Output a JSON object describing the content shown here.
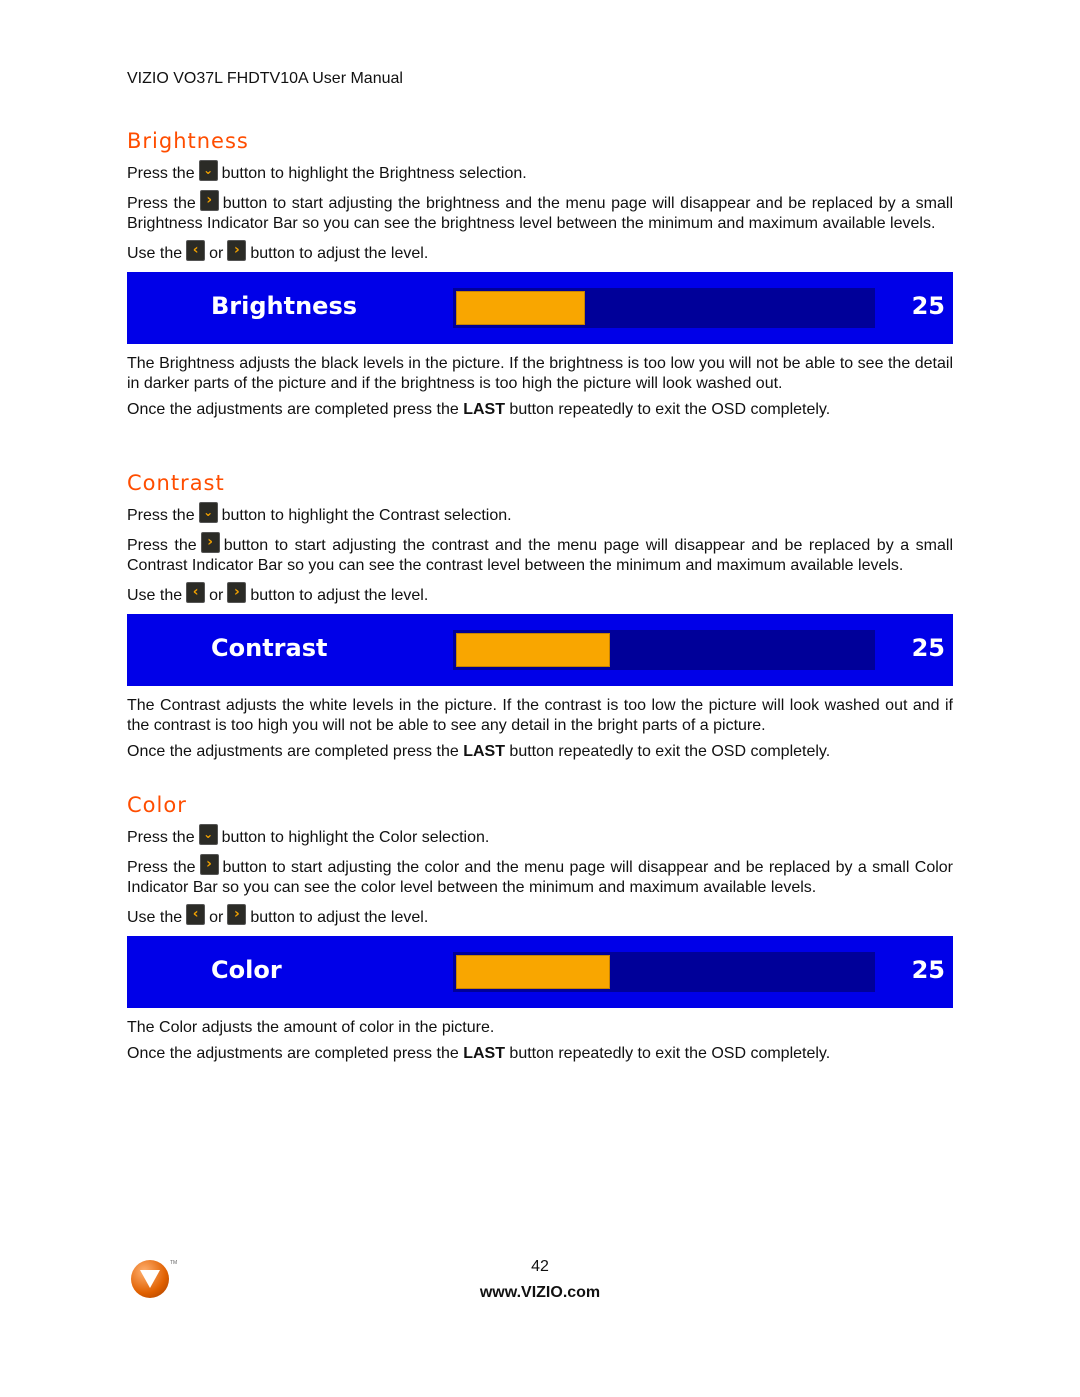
{
  "header": {
    "title": "VIZIO VO37L FHDTV10A User Manual"
  },
  "sections": [
    {
      "title": "Brightness",
      "highlight": {
        "pre": "Press the",
        "post": "button to highlight the Brightness selection."
      },
      "start": {
        "pre": "Press the",
        "post": "button to start adjusting the brightness and the menu page will disappear and be replaced by a small Brightness Indicator Bar so you can see the brightness level between the minimum and maximum available levels."
      },
      "adjust": {
        "pre": "Use the",
        "or": "or",
        "post": "button to adjust the level."
      },
      "osd": {
        "label": "Brightness",
        "value": "25",
        "fill_fraction": 0.31
      },
      "description": "The Brightness adjusts the black levels in the picture.  If the brightness is too low you will not be able to see the detail in darker parts of the picture and if the brightness is too high the picture will look washed out.",
      "exit": {
        "pre": "Once the adjustments are completed press the",
        "bold": "LAST",
        "post": "button repeatedly to exit the OSD completely."
      }
    },
    {
      "title": "Contrast",
      "highlight": {
        "pre": "Press the",
        "post": "button to highlight the Contrast selection."
      },
      "start": {
        "pre": "Press the",
        "post": "button to start adjusting the contrast and the menu page will disappear and be replaced by a small Contrast Indicator Bar so you can see the contrast level between the minimum and maximum available levels."
      },
      "adjust": {
        "pre": "Use the",
        "or": "or",
        "post": "button to adjust the level."
      },
      "osd": {
        "label": "Contrast",
        "value": "25",
        "fill_fraction": 0.37
      },
      "description": "The Contrast adjusts the white levels in the picture.  If the contrast is too low the picture will look washed out and if the contrast is too high you will not be able to see any detail in the bright parts of a picture.",
      "exit": {
        "pre": "Once the adjustments are completed press the",
        "bold": "LAST",
        "post": "button repeatedly to exit the OSD completely."
      }
    },
    {
      "title": "Color",
      "highlight": {
        "pre": "Press the",
        "post": "button to highlight the Color selection."
      },
      "start": {
        "pre": "Press the",
        "post": "button to start adjusting the color and the menu page will disappear and be replaced by a small Color Indicator Bar so you can see the color level between the minimum and maximum available levels."
      },
      "adjust": {
        "pre": "Use the",
        "or": "or",
        "post": "button to adjust the level."
      },
      "osd": {
        "label": "Color",
        "value": "25",
        "fill_fraction": 0.37
      },
      "description": "The Color adjusts the amount of color in the picture.",
      "exit": {
        "pre": "Once the adjustments are completed press the",
        "bold": "LAST",
        "post": "button repeatedly to exit the OSD completely."
      }
    }
  ],
  "icons": {
    "channel_down": "ch-down-icon",
    "right": "right-arrow-icon",
    "left": "left-arrow-icon"
  },
  "colors": {
    "section_title": "#ff4d00",
    "osd_bg": "#0000e8",
    "osd_track": "#000099",
    "osd_fill": "#f9a600"
  },
  "footer": {
    "page_number": "42",
    "url": "www.VIZIO.com",
    "trademark": "TM"
  }
}
